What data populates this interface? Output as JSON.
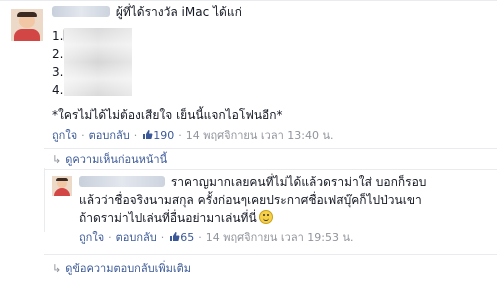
{
  "main_comment": {
    "author_suffix": "ผู้ที่ได้รางวัล iMac ได้แก่",
    "item_1": "1.",
    "item_2": "2.",
    "item_3": "3.",
    "item_4": "4.",
    "text_2": "*ใครไม่ได้ไม่ต้องเสียใจ เย็นนี้แจกไอโฟนอีก*",
    "like_label": "ถูกใจ",
    "reply_label": "ตอบกลับ",
    "like_count": "190",
    "timestamp": "14 พฤศจิกายน เวลา 13:40 น."
  },
  "view_previous": "ดูความเห็นก่อนหน้านี้",
  "reply_comment": {
    "line_1": "ราคาญมากเลยคนที่ไม่ได้แล้วดราม่าใส่ บอกก็รอบ",
    "line_2": "แล้วว่าชื่อจริงนามสกุล ครั้งก่อนๆเคยประกาศชื่อเฟสบุ๊คก็ไปป่วนเขา",
    "line_3": "ถ้าดราม่าไปเล่นที่อื่นอย่ามาเล่นที่นี่",
    "like_label": "ถูกใจ",
    "reply_label": "ตอบกลับ",
    "like_count": "65",
    "timestamp": "14 พฤศจิกายน เวลา 19:53 น."
  },
  "view_more_replies": "ดูข้อความตอบกลับเพิ่มเติม",
  "colors": {
    "link": "#3b5998",
    "meta": "#90949c",
    "text": "#141823",
    "divider": "#e9ebee"
  },
  "icons": [
    "like-thumb-icon",
    "reply-arrow-icon",
    "smile-emoji-icon"
  ]
}
